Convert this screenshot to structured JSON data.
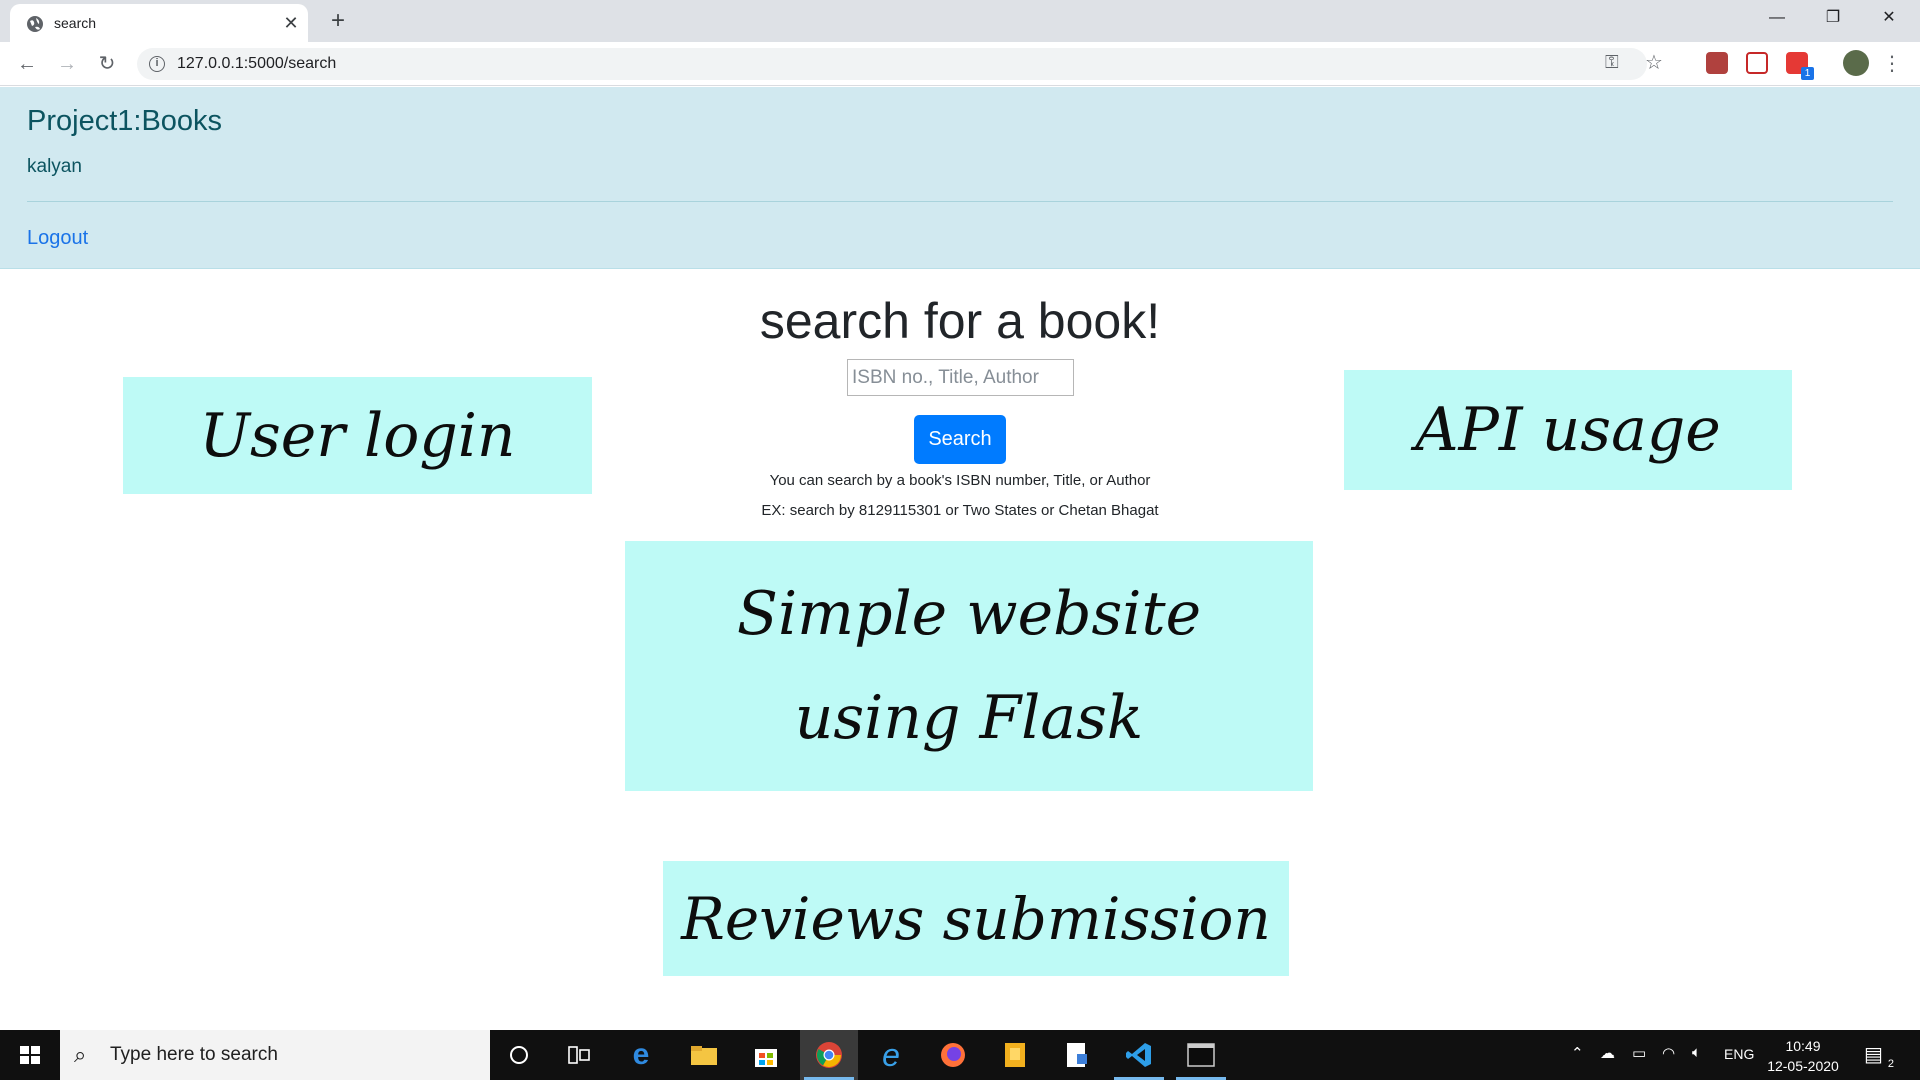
{
  "browser": {
    "tab_title": "search",
    "url": "127.0.0.1:5000/search",
    "extension_badge": "1"
  },
  "navbar": {
    "brand": "Project1:Books",
    "username": "kalyan",
    "logout_label": "Logout"
  },
  "search": {
    "heading": "search for a book!",
    "placeholder": "ISBN no., Title, Author",
    "value": "",
    "button_label": "Search",
    "hint_line1": "You can search by a book's ISBN number, Title, or Author",
    "hint_line2": "EX: search by 8129115301 or Two States or Chetan Bhagat"
  },
  "notes": {
    "user_login": "User login",
    "api_usage": "API usage",
    "flask_line1": "Simple website",
    "flask_line2": "using Flask",
    "reviews": "Reviews submission"
  },
  "taskbar": {
    "search_placeholder": "Type here to search",
    "language": "ENG",
    "time": "10:49",
    "date": "12-05-2020",
    "notification_count": "2"
  },
  "colors": {
    "navbar_bg": "#d1e9f0",
    "brand_text": "#0c5460",
    "primary_button": "#007bff",
    "note_bg": "#befaf6"
  }
}
